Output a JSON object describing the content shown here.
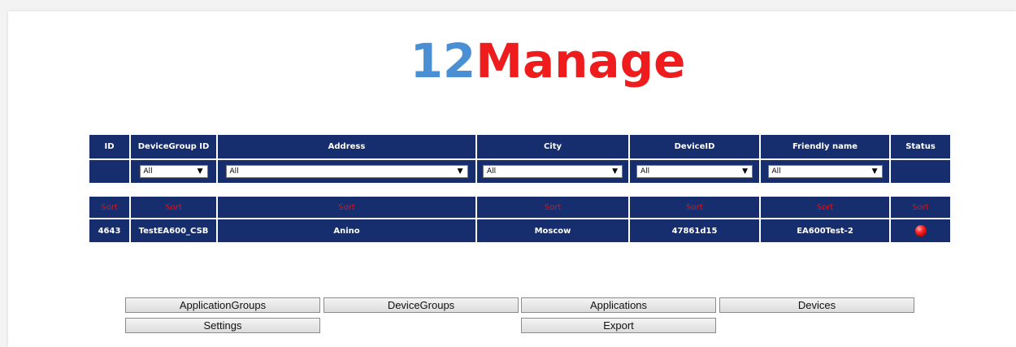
{
  "logo": {
    "part1": "12",
    "part2": "Manage"
  },
  "columns": [
    "ID",
    "DeviceGroup ID",
    "Address",
    "City",
    "DeviceID",
    "Friendly name",
    "Status"
  ],
  "filters": {
    "devicegroup": "All",
    "address": "All",
    "city": "All",
    "deviceid": "All",
    "friendly_name": "All"
  },
  "sort_label": "Sort",
  "rows": [
    {
      "id": "4643",
      "devicegroup_id": "TestEA600_CSB",
      "address": "Anino",
      "city": "Moscow",
      "device_id": "47861d15",
      "friendly_name": "EA600Test-2",
      "status": "offline"
    }
  ],
  "buttons": {
    "application_groups": "ApplicationGroups",
    "device_groups": "DeviceGroups",
    "applications": "Applications",
    "devices": "Devices",
    "settings": "Settings",
    "export": "Export"
  },
  "colors": {
    "header_bg": "#162e6e",
    "sort_text": "#e81010",
    "logo_number": "#4a8fd4",
    "logo_word": "#ee1c1c",
    "status_offline": "#ff2a2a"
  }
}
